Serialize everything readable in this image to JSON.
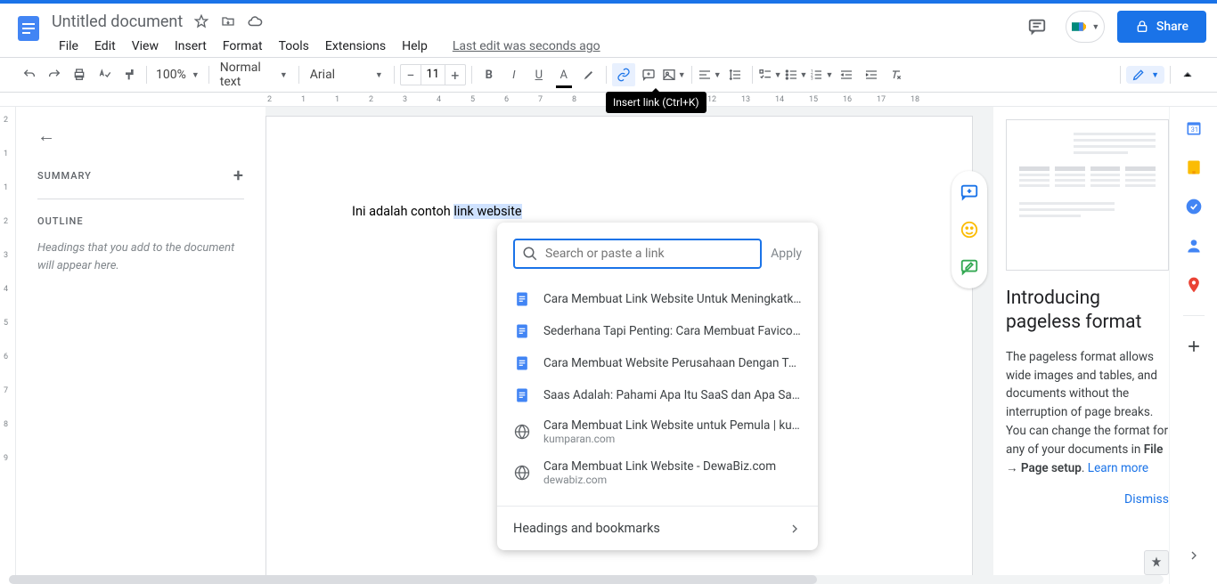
{
  "header": {
    "title": "Untitled document",
    "last_edit": "Last edit was seconds ago",
    "share": "Share"
  },
  "menus": [
    "File",
    "Edit",
    "View",
    "Insert",
    "Format",
    "Tools",
    "Extensions",
    "Help"
  ],
  "toolbar": {
    "zoom": "100%",
    "style": "Normal text",
    "font": "Arial",
    "size": "11",
    "tooltip": "Insert link (Ctrl+K)"
  },
  "outline": {
    "summary": "SUMMARY",
    "outline": "OUTLINE",
    "empty": "Headings that you add to the document will appear here."
  },
  "document": {
    "text_before": "Ini adalah contoh ",
    "text_selected": "link website"
  },
  "link_popup": {
    "placeholder": "Search or paste a link",
    "apply": "Apply",
    "suggestions": [
      {
        "type": "doc",
        "title": "Cara Membuat Link Website Untuk Meningkatkan S..."
      },
      {
        "type": "doc",
        "title": "Sederhana Tapi Penting: Cara Membuat Favicon Di ..."
      },
      {
        "type": "doc",
        "title": "Cara Membuat Website Perusahaan Dengan Tampil..."
      },
      {
        "type": "doc",
        "title": "Saas Adalah: Pahami Apa Itu SaaS dan Apa Saja Co..."
      },
      {
        "type": "web",
        "title": "Cara Membuat Link Website untuk Pemula | kumpar...",
        "sub": "kumparan.com"
      },
      {
        "type": "web",
        "title": "Cara Membuat Link Website - DewaBiz.com",
        "sub": "dewabiz.com"
      }
    ],
    "headings": "Headings and bookmarks"
  },
  "right_panel": {
    "title": "Introducing pageless format",
    "body_1": "The pageless format allows wide images and tables, and documents without the interruption of page breaks. You can change the format for any of your documents in ",
    "body_bold": "File → Page setup",
    "body_2": ". ",
    "learn": "Learn more",
    "dismiss": "Dismiss"
  },
  "ruler": {
    "h": [
      "2",
      "1",
      "1",
      "2",
      "3",
      "4",
      "5",
      "6",
      "7",
      "8",
      "9",
      "10",
      "11",
      "12",
      "13",
      "14",
      "15",
      "16",
      "17",
      "18"
    ],
    "v": [
      "2",
      "1",
      "1",
      "2",
      "3",
      "4",
      "5",
      "6",
      "7",
      "8",
      "9"
    ]
  }
}
